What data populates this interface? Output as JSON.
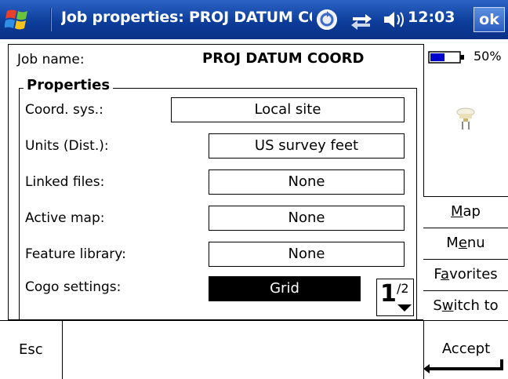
{
  "titlebar": {
    "title": "Job properties: PROJ DATUM COORD",
    "clock": "12:03",
    "ok_label": "ok"
  },
  "job": {
    "name_label": "Job name:",
    "name_value": "PROJ DATUM COORD"
  },
  "properties": {
    "group_title": "Properties",
    "rows": [
      {
        "label": "Coord. sys.:",
        "value": "Local site"
      },
      {
        "label": "Units (Dist.):",
        "value": "US survey feet"
      },
      {
        "label": "Linked files:",
        "value": "None"
      },
      {
        "label": "Active map:",
        "value": "None"
      },
      {
        "label": "Feature library:",
        "value": "None"
      },
      {
        "label": "Cogo settings:",
        "value": "Grid"
      }
    ]
  },
  "status": {
    "battery_percent": "50%",
    "battery_level": 0.5
  },
  "side_menu": {
    "map": {
      "pre": "",
      "u": "M",
      "post": "ap"
    },
    "menu": {
      "pre": "M",
      "u": "e",
      "post": "nu"
    },
    "favorites": {
      "pre": "F",
      "u": "a",
      "post": "vorites"
    },
    "switch_to": {
      "pre": "S",
      "u": "w",
      "post": "itch to"
    }
  },
  "pager": {
    "current": "1",
    "total": "/2"
  },
  "bottom": {
    "esc_label": "Esc",
    "accept_label": "Accept"
  },
  "colors": {
    "titlebar": "#0d3d9a",
    "ok_button": "#2a5cc0",
    "battery_fill": "#0000cc"
  }
}
